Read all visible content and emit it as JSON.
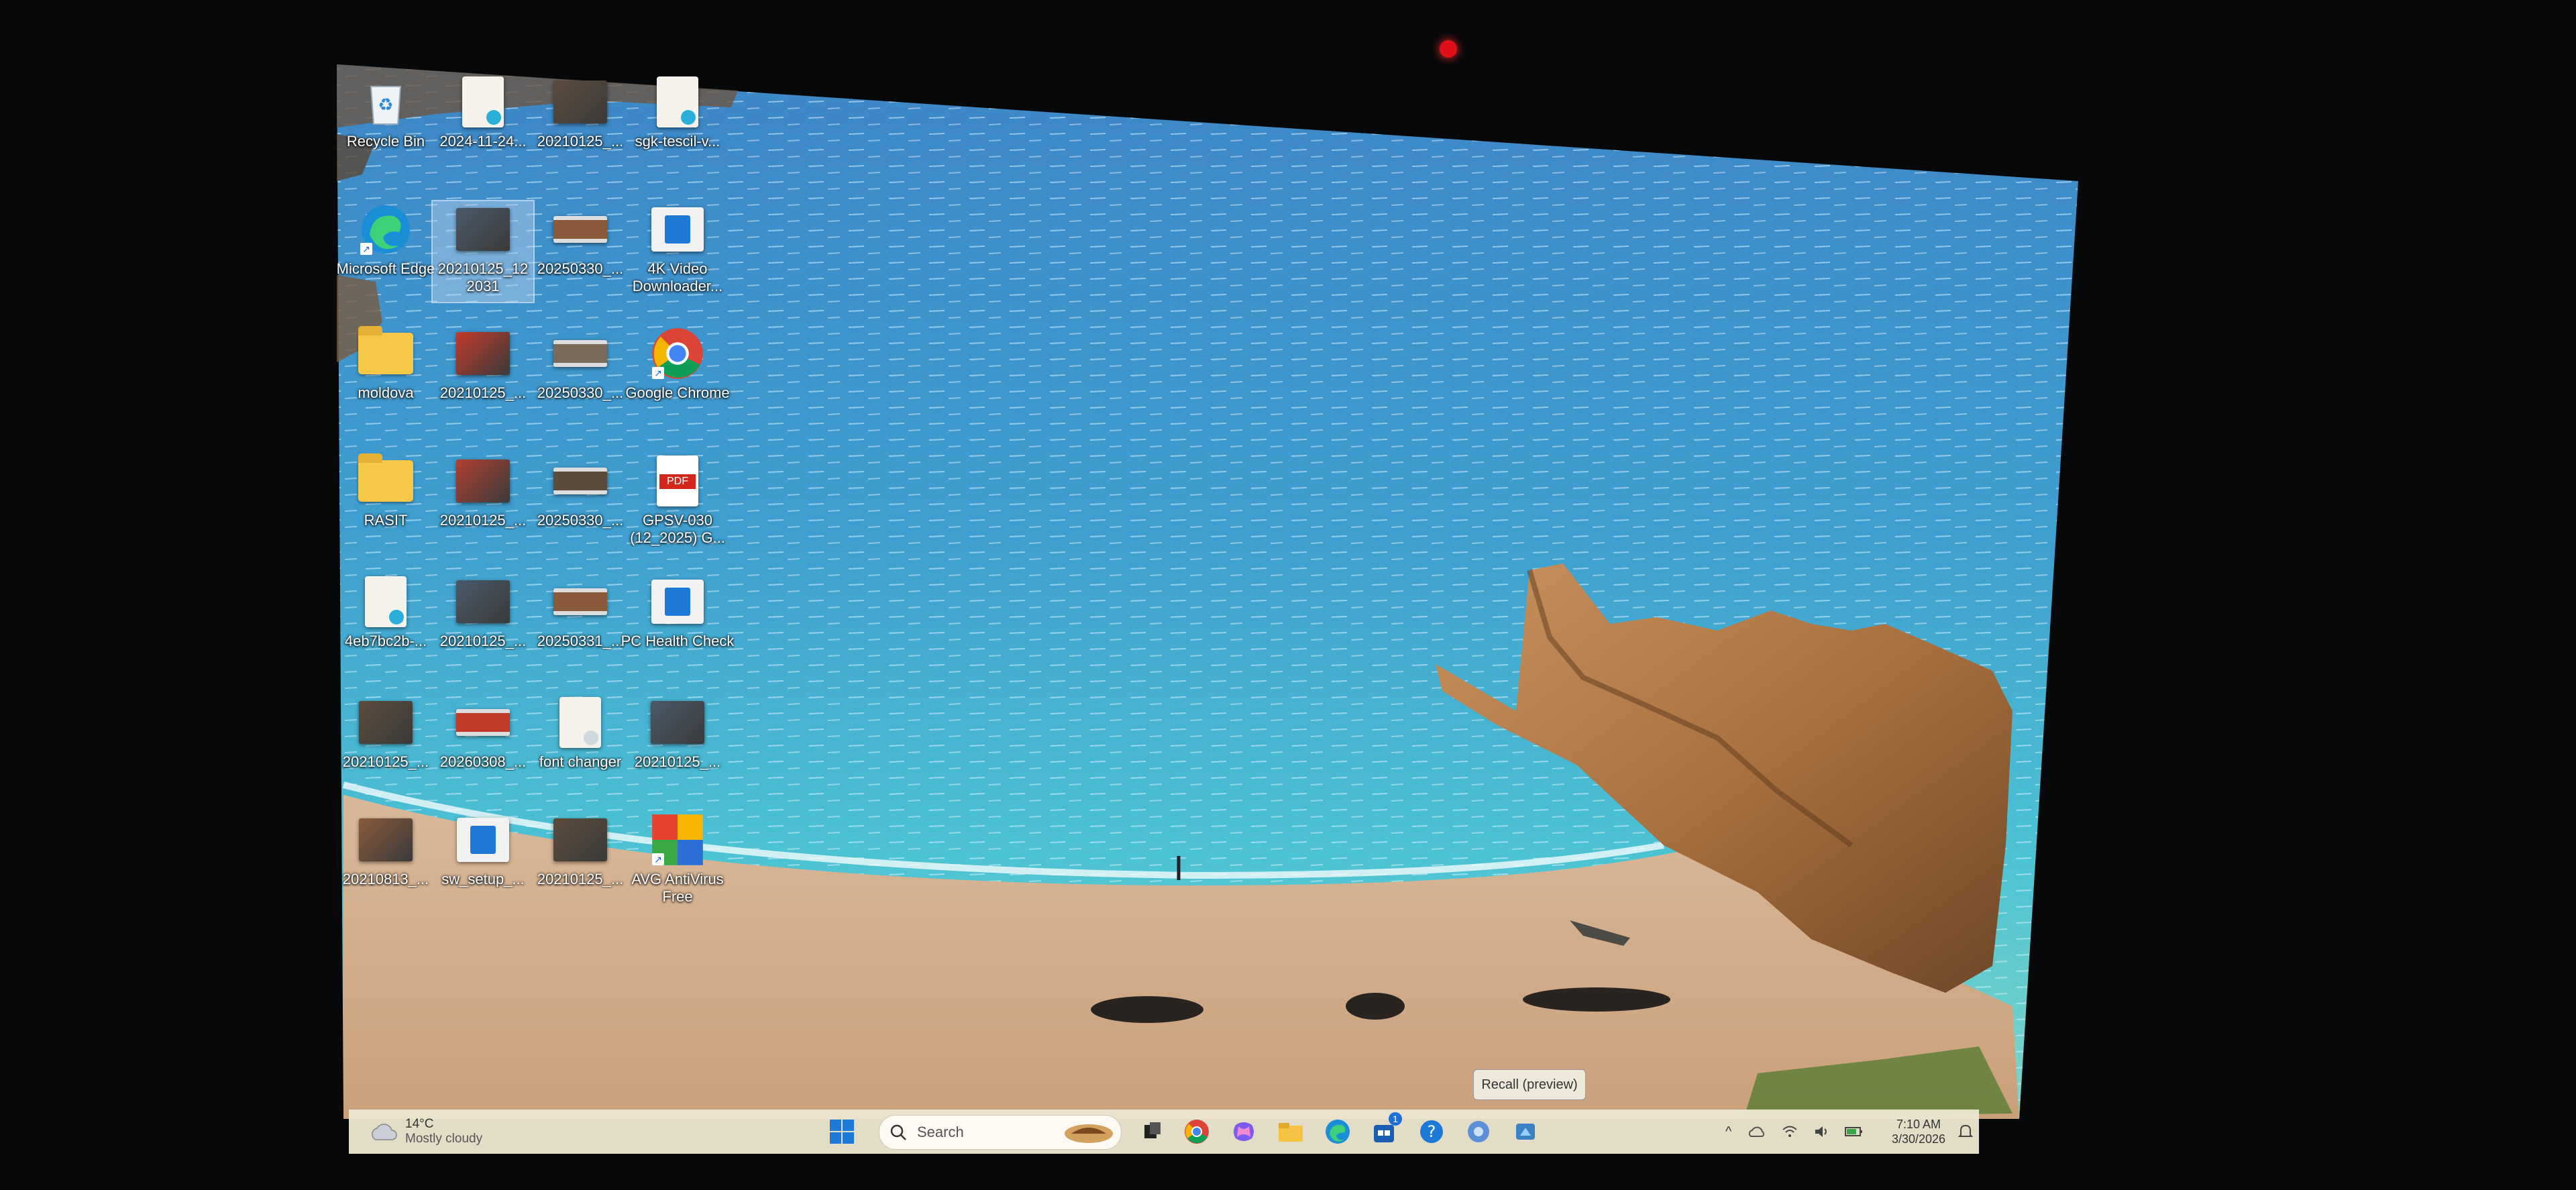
{
  "desktop": {
    "icons": [
      {
        "label": "Recycle Bin",
        "kind": "recycle-bin-icon"
      },
      {
        "label": "2024-11-24...",
        "kind": "edge-document-icon"
      },
      {
        "label": "20210125_...",
        "kind": "photo-thumbnail"
      },
      {
        "label": "sgk-tescil-v...",
        "kind": "edge-document-icon"
      },
      {
        "label": "Microsoft Edge",
        "kind": "edge-icon"
      },
      {
        "label": "20210125_12 2031",
        "kind": "photo-thumbnail"
      },
      {
        "label": "20250330_...",
        "kind": "video-thumbnail"
      },
      {
        "label": "4K Video Downloader...",
        "kind": "app-icon"
      },
      {
        "label": "moldova",
        "kind": "folder-icon"
      },
      {
        "label": "20210125_...",
        "kind": "photo-thumbnail"
      },
      {
        "label": "20250330_...",
        "kind": "video-thumbnail"
      },
      {
        "label": "Google Chrome",
        "kind": "chrome-icon"
      },
      {
        "label": "RASIT",
        "kind": "folder-icon"
      },
      {
        "label": "20210125_...",
        "kind": "photo-thumbnail"
      },
      {
        "label": "20250330_...",
        "kind": "video-thumbnail"
      },
      {
        "label": "GPSV-030 (12_2025) G...",
        "kind": "pdf-icon"
      },
      {
        "label": "4eb7bc2b-...",
        "kind": "map-document-icon"
      },
      {
        "label": "20210125_...",
        "kind": "photo-thumbnail"
      },
      {
        "label": "20250331_...",
        "kind": "video-thumbnail"
      },
      {
        "label": "PC Health Check",
        "kind": "app-icon"
      },
      {
        "label": "20210125_...",
        "kind": "photo-thumbnail"
      },
      {
        "label": "20260308_...",
        "kind": "video-thumbnail"
      },
      {
        "label": "font changer",
        "kind": "document-icon"
      },
      {
        "label": "20210125_...",
        "kind": "photo-thumbnail"
      },
      {
        "label": "20210813_...",
        "kind": "photo-thumbnail"
      },
      {
        "label": "sw_setup_...",
        "kind": "app-icon"
      },
      {
        "label": "20210125_...",
        "kind": "photo-thumbnail"
      },
      {
        "label": "AVG AntiVirus Free",
        "kind": "avg-icon"
      }
    ]
  },
  "tooltip": {
    "text": "Recall (preview)"
  },
  "taskbar": {
    "weather": {
      "temp": "14°C",
      "condition": "Mostly cloudy",
      "icon": "cloud-icon"
    },
    "search": {
      "placeholder": "Search"
    },
    "start_icon": "windows-start-icon",
    "pinned": [
      "task-view-icon",
      "chrome-icon",
      "copilot-icon",
      "file-explorer-icon",
      "edge-icon",
      "store-icon",
      "help-icon",
      "network-icon",
      "recall-icon"
    ],
    "store_badge": "1",
    "clock": {
      "time": "7:10 AM",
      "date": "3/30/2026"
    }
  },
  "colors": {
    "taskbar_bg": "#ece6d0",
    "accent": "#1c6fd6",
    "camera_led": "#e0101a"
  }
}
